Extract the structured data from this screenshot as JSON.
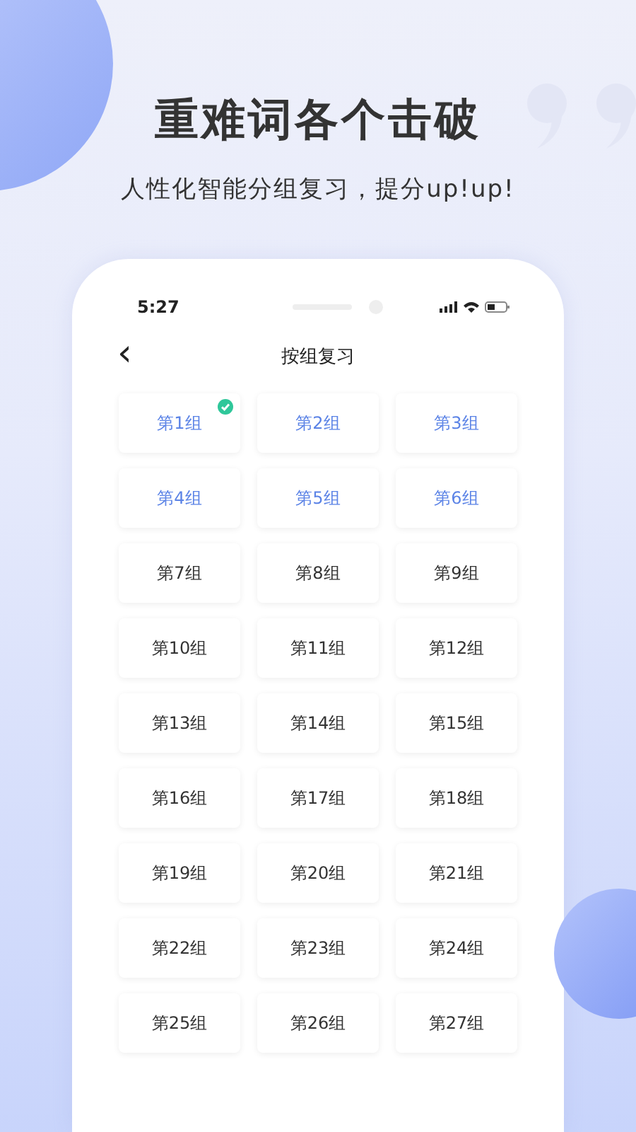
{
  "headline": "重难词各个击破",
  "subtitle": "人性化智能分组复习，提分up!up!",
  "status_bar": {
    "time": "5:27"
  },
  "nav": {
    "back": "‹",
    "title": "按组复习"
  },
  "groups": [
    {
      "label": "第1组",
      "learned": true,
      "checked": true
    },
    {
      "label": "第2组",
      "learned": true,
      "checked": false
    },
    {
      "label": "第3组",
      "learned": true,
      "checked": false
    },
    {
      "label": "第4组",
      "learned": true,
      "checked": false
    },
    {
      "label": "第5组",
      "learned": true,
      "checked": false
    },
    {
      "label": "第6组",
      "learned": true,
      "checked": false
    },
    {
      "label": "第7组",
      "learned": false,
      "checked": false
    },
    {
      "label": "第8组",
      "learned": false,
      "checked": false
    },
    {
      "label": "第9组",
      "learned": false,
      "checked": false
    },
    {
      "label": "第10组",
      "learned": false,
      "checked": false
    },
    {
      "label": "第11组",
      "learned": false,
      "checked": false
    },
    {
      "label": "第12组",
      "learned": false,
      "checked": false
    },
    {
      "label": "第13组",
      "learned": false,
      "checked": false
    },
    {
      "label": "第14组",
      "learned": false,
      "checked": false
    },
    {
      "label": "第15组",
      "learned": false,
      "checked": false
    },
    {
      "label": "第16组",
      "learned": false,
      "checked": false
    },
    {
      "label": "第17组",
      "learned": false,
      "checked": false
    },
    {
      "label": "第18组",
      "learned": false,
      "checked": false
    },
    {
      "label": "第19组",
      "learned": false,
      "checked": false
    },
    {
      "label": "第20组",
      "learned": false,
      "checked": false
    },
    {
      "label": "第21组",
      "learned": false,
      "checked": false
    },
    {
      "label": "第22组",
      "learned": false,
      "checked": false
    },
    {
      "label": "第23组",
      "learned": false,
      "checked": false
    },
    {
      "label": "第24组",
      "learned": false,
      "checked": false
    },
    {
      "label": "第25组",
      "learned": false,
      "checked": false
    },
    {
      "label": "第26组",
      "learned": false,
      "checked": false
    },
    {
      "label": "第27组",
      "learned": false,
      "checked": false
    }
  ]
}
